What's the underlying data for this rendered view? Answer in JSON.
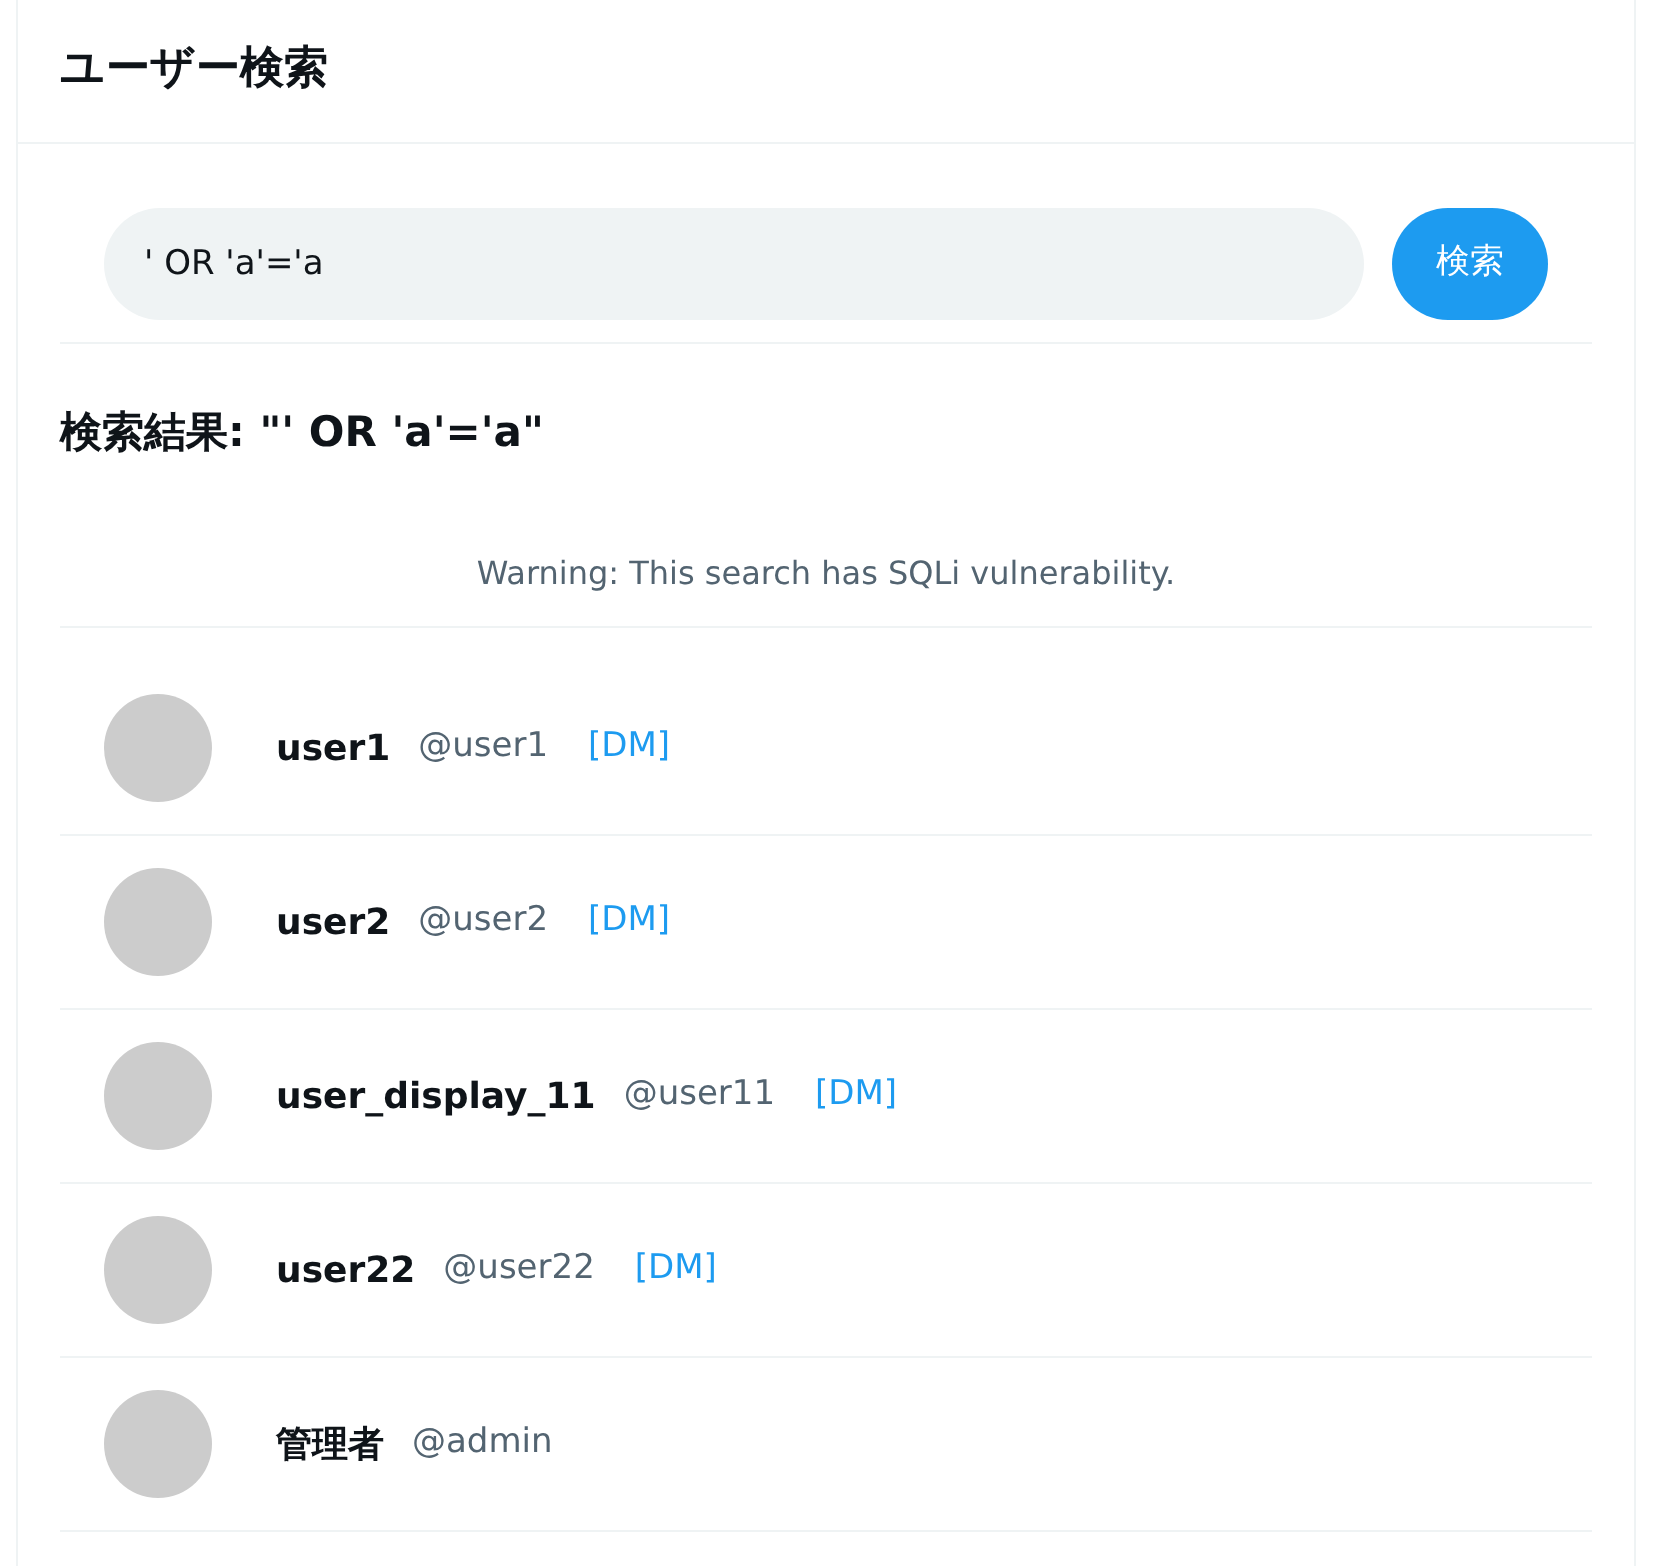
{
  "header": {
    "title": "ユーザー検索"
  },
  "search": {
    "value": "' OR 'a'='a",
    "button": "検索"
  },
  "results": {
    "heading": "検索結果: \"' OR 'a'='a\"",
    "warning": "Warning: This search has SQLi vulnerability."
  },
  "users": [
    {
      "name": "user1",
      "handle": "@user1",
      "dm": "[DM]"
    },
    {
      "name": "user2",
      "handle": "@user2",
      "dm": "[DM]"
    },
    {
      "name": "user_display_11",
      "handle": "@user11",
      "dm": "[DM]"
    },
    {
      "name": "user22",
      "handle": "@user22",
      "dm": "[DM]"
    },
    {
      "name": "管理者",
      "handle": "@admin"
    }
  ]
}
